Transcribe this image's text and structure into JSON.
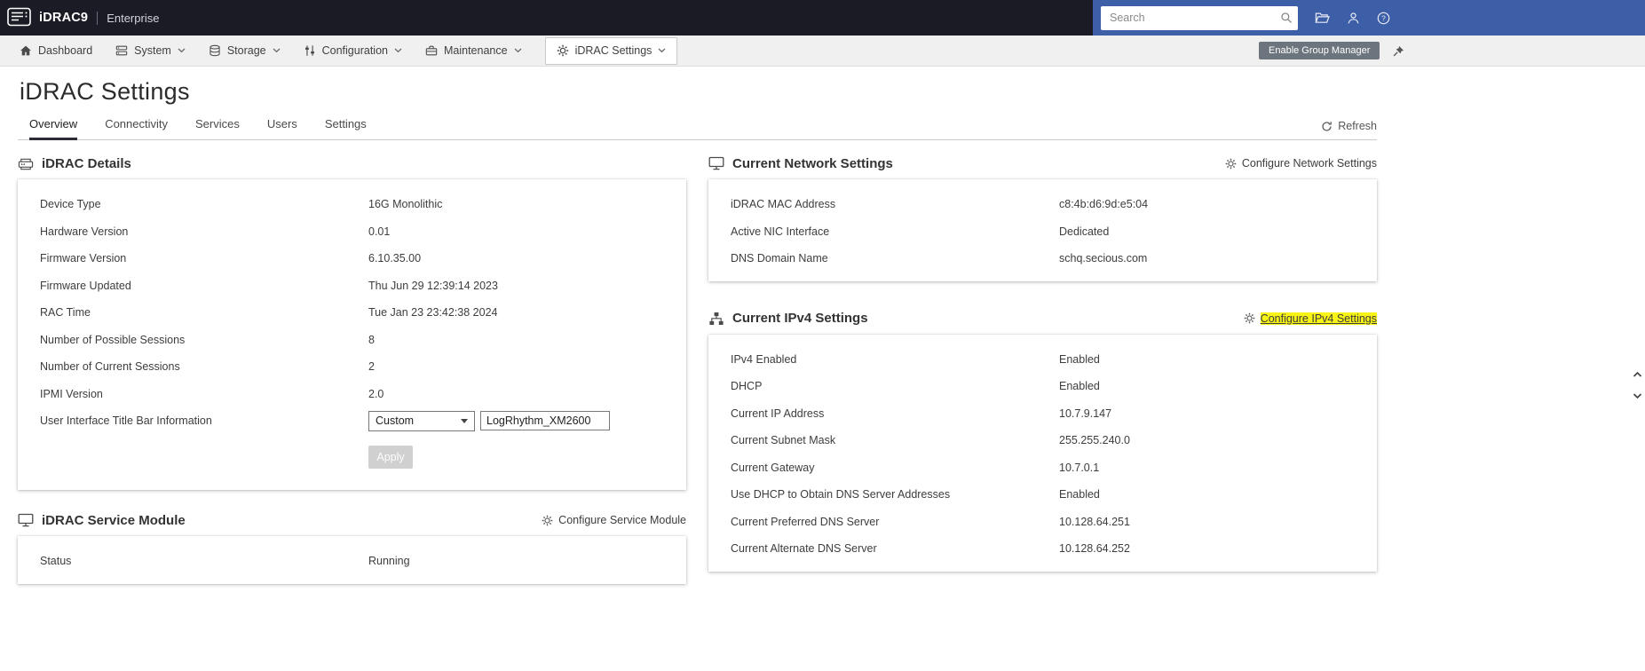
{
  "colors": {
    "header_dark": "#1b1b25",
    "header_blue": "#3d5fa8",
    "menubar_bg": "#f0f0f0",
    "active_tab_underline": "#2c2c38",
    "highlight_yellow": "#f8f415",
    "group_manager_button": "#6c757d"
  },
  "header": {
    "brand": "iDRAC9",
    "edition": "Enterprise",
    "search_placeholder": "Search"
  },
  "menubar": {
    "items": [
      {
        "label": "Dashboard"
      },
      {
        "label": "System"
      },
      {
        "label": "Storage"
      },
      {
        "label": "Configuration"
      },
      {
        "label": "Maintenance"
      },
      {
        "label": "iDRAC Settings"
      }
    ],
    "enable_group_manager": "Enable Group Manager"
  },
  "page": {
    "title": "iDRAC Settings",
    "tabs": [
      {
        "label": "Overview"
      },
      {
        "label": "Connectivity"
      },
      {
        "label": "Services"
      },
      {
        "label": "Users"
      },
      {
        "label": "Settings"
      }
    ],
    "active_tab": "Overview",
    "refresh": "Refresh"
  },
  "cards": {
    "idrac_details": {
      "title": "iDRAC Details",
      "rows": [
        {
          "label": "Device Type",
          "value": "16G Monolithic"
        },
        {
          "label": "Hardware Version",
          "value": "0.01"
        },
        {
          "label": "Firmware Version",
          "value": "6.10.35.00"
        },
        {
          "label": "Firmware Updated",
          "value": "Thu Jun 29 12:39:14 2023"
        },
        {
          "label": "RAC Time",
          "value": "Tue Jan 23 23:42:38 2024"
        },
        {
          "label": "Number of Possible Sessions",
          "value": "8"
        },
        {
          "label": "Number of Current Sessions",
          "value": "2"
        },
        {
          "label": "IPMI Version",
          "value": "2.0"
        }
      ],
      "title_bar": {
        "label": "User Interface Title Bar Information",
        "select_value": "Custom",
        "input_value": "LogRhythm_XM2600"
      },
      "apply": "Apply"
    },
    "network": {
      "title": "Current Network Settings",
      "action": "Configure Network Settings",
      "rows": [
        {
          "label": "iDRAC MAC Address",
          "value": "c8:4b:d6:9d:e5:04"
        },
        {
          "label": "Active NIC Interface",
          "value": "Dedicated"
        },
        {
          "label": "DNS Domain Name",
          "value": "schq.secious.com"
        }
      ]
    },
    "ipv4": {
      "title": "Current IPv4 Settings",
      "action": "Configure IPv4 Settings",
      "rows": [
        {
          "label": "IPv4 Enabled",
          "value": "Enabled"
        },
        {
          "label": "DHCP",
          "value": "Enabled"
        },
        {
          "label": "Current IP Address",
          "value": "10.7.9.147"
        },
        {
          "label": "Current Subnet Mask",
          "value": "255.255.240.0"
        },
        {
          "label": "Current Gateway",
          "value": "10.7.0.1"
        },
        {
          "label": "Use DHCP to Obtain DNS Server Addresses",
          "value": "Enabled"
        },
        {
          "label": "Current Preferred DNS Server",
          "value": "10.128.64.251"
        },
        {
          "label": "Current Alternate DNS Server",
          "value": "10.128.64.252"
        }
      ]
    },
    "service_module": {
      "title": "iDRAC Service Module",
      "action": "Configure Service Module",
      "rows": [
        {
          "label": "Status",
          "value": "Running"
        }
      ]
    }
  }
}
